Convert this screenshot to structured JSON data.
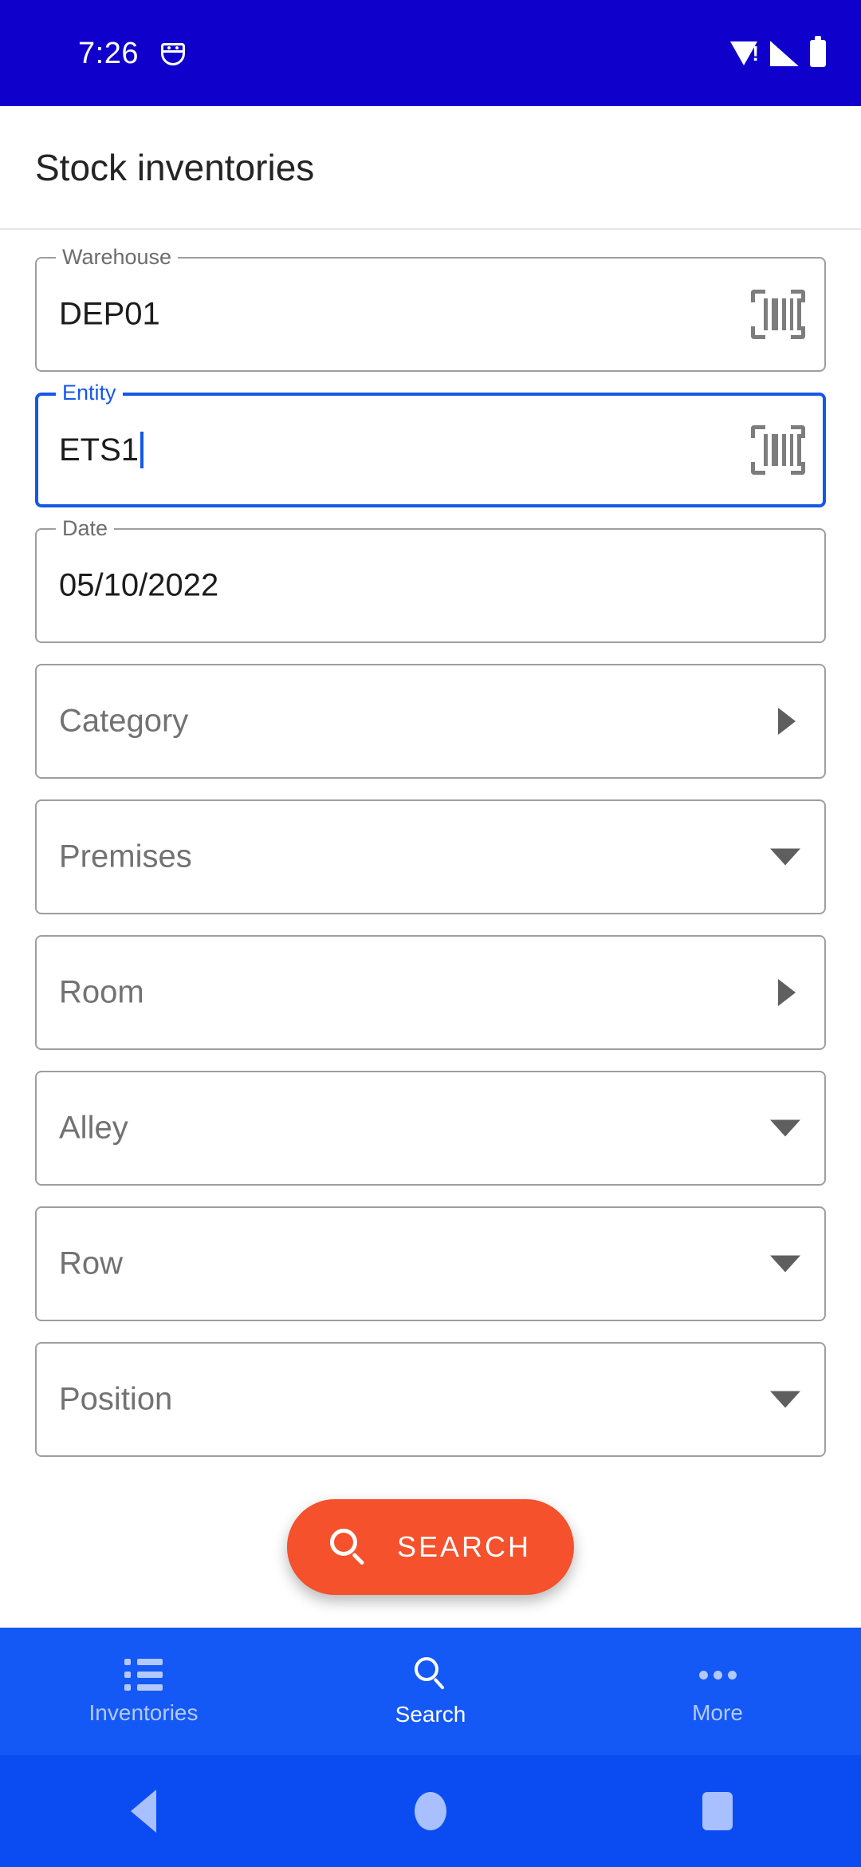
{
  "status_bar": {
    "time": "7:26",
    "icons": [
      "android-debug-icon",
      "wifi-alert-icon",
      "cellular-signal-icon",
      "battery-icon"
    ],
    "background_color": "#1000cc"
  },
  "header": {
    "title": "Stock inventories"
  },
  "form": {
    "fields": [
      {
        "name": "warehouse",
        "label": "Warehouse",
        "value": "DEP01",
        "focused": false,
        "trailing": "barcode-scan-icon"
      },
      {
        "name": "entity",
        "label": "Entity",
        "value": "ETS1",
        "focused": true,
        "trailing": "barcode-scan-icon"
      },
      {
        "name": "date",
        "label": "Date",
        "value": "05/10/2022",
        "focused": false,
        "trailing": "none"
      },
      {
        "name": "category",
        "placeholder": "Category",
        "focused": false,
        "trailing": "triangle-right-icon"
      },
      {
        "name": "premises",
        "placeholder": "Premises",
        "focused": false,
        "trailing": "triangle-down-icon"
      },
      {
        "name": "room",
        "placeholder": "Room",
        "focused": false,
        "trailing": "triangle-right-icon"
      },
      {
        "name": "alley",
        "placeholder": "Alley",
        "focused": false,
        "trailing": "triangle-down-icon"
      },
      {
        "name": "row",
        "placeholder": "Row",
        "focused": false,
        "trailing": "triangle-down-icon"
      },
      {
        "name": "position",
        "placeholder": "Position",
        "focused": false,
        "trailing": "triangle-down-icon"
      }
    ]
  },
  "fab": {
    "label": "SEARCH",
    "icon": "search-icon",
    "color": "#f4512c"
  },
  "bottom_nav": {
    "background_color": "#1458f5",
    "items": [
      {
        "label": "Inventories",
        "icon": "list-icon",
        "active": false
      },
      {
        "label": "Search",
        "icon": "search-icon",
        "active": true
      },
      {
        "label": "More",
        "icon": "more-dots-icon",
        "active": false
      }
    ]
  },
  "android_nav": {
    "background_color": "#0b4cf2",
    "buttons": [
      "back-button",
      "home-button",
      "recents-button"
    ]
  },
  "colors": {
    "accent_blue": "#1558e8",
    "status_blue": "#1000cc",
    "nav_blue": "#1458f5",
    "fab_orange": "#f4512c",
    "field_border": "#9e9e9e",
    "placeholder_text": "#727272"
  }
}
